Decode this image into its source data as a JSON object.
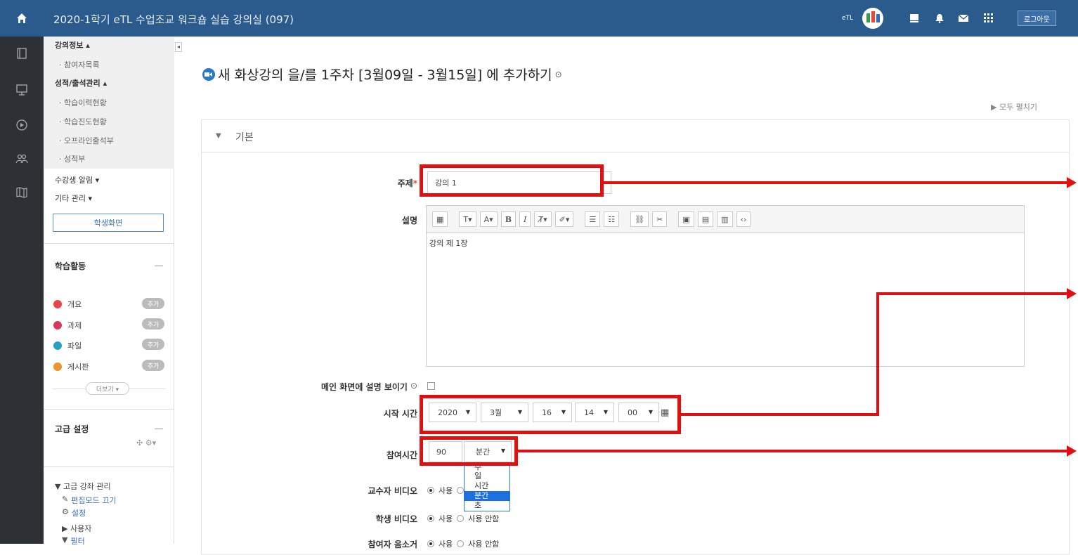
{
  "header": {
    "title": "2020-1학기 eTL 수업조교 워크숍 실습 강의실 (097)",
    "etl_label": "eTL",
    "logout_label": "로그아웃"
  },
  "sidebar": {
    "course_info": "강의정보 ▴",
    "participants": "· 참여자목록",
    "grades_attendance": "성적/출석관리 ▴",
    "learning_history": "· 학습이력현황",
    "learning_progress": "· 학습진도현황",
    "offline_attendance": "· 오프라인출석부",
    "gradebook": "· 성적부",
    "student_alerts": "수강생 알림 ▾",
    "other_management": "기타 관리 ▾",
    "student_view_button": "학생화면",
    "activities_title": "학습활동",
    "activities": [
      {
        "label": "개요",
        "color": "#e8454a",
        "add": "추가"
      },
      {
        "label": "과제",
        "color": "#d9385e",
        "add": "추가"
      },
      {
        "label": "파일",
        "color": "#2aa0c8",
        "add": "추가"
      },
      {
        "label": "게시판",
        "color": "#f0932b",
        "add": "추가"
      }
    ],
    "more_button": "더보기 ▾",
    "advanced_title": "고급 설정",
    "advanced_course_mgmt": "▼ 고급 강좌 관리",
    "edit_mode_off": "편집모드 끄기",
    "settings": "설정",
    "users": "▶ 사용자",
    "filter": "필터"
  },
  "main": {
    "page_heading": "새 화상강의 을/를 1주차 [3월09일 - 3월15일] 에 추가하기",
    "expand_all": "▶ 모두 펼치기",
    "section_label": "기본",
    "subject_label": "주제",
    "subject_required": "*",
    "subject_value": "강의 1",
    "description_label": "설명",
    "description_text": "강의 제 1장",
    "show_description_label": "메인 화면에 설명 보이기",
    "start_time_label": "시작 시간",
    "start_year": "2020",
    "start_month": "3월",
    "start_day": "16",
    "start_hour": "14",
    "start_minute": "00",
    "duration_label": "참여시간",
    "duration_value": "90",
    "duration_unit": "분간",
    "unit_options": [
      "주",
      "일",
      "시간",
      "분간",
      "초"
    ],
    "professor_video_label": "교수자 비디오",
    "student_video_label": "학생 비디오",
    "participant_audio_label": "참여자 음소거",
    "use_label": "사용",
    "not_use_label": "사용 안함"
  },
  "annotation_color": "#e01010"
}
